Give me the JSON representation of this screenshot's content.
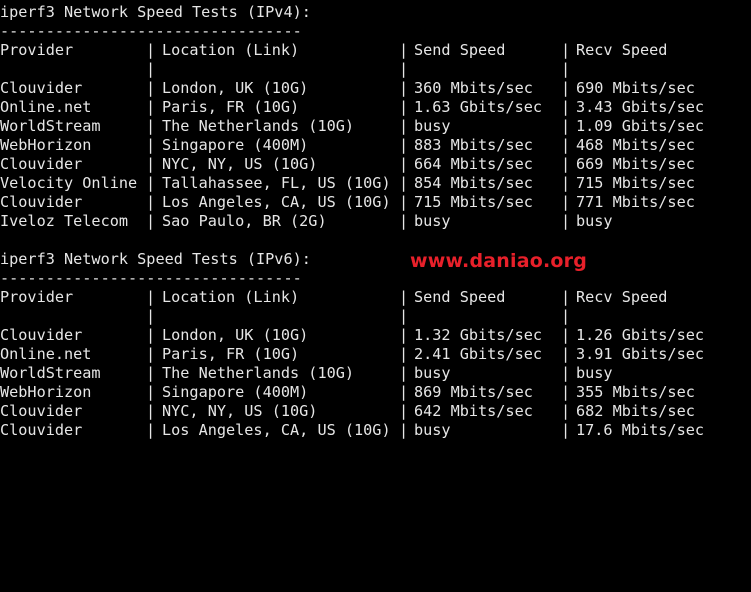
{
  "ipv4": {
    "title": "iperf3 Network Speed Tests (IPv4):",
    "dashes": "---------------------------------",
    "header": {
      "provider": "Provider",
      "location": "Location (Link)",
      "send": "Send Speed",
      "recv": "Recv Speed"
    },
    "separator": "|",
    "rows": [
      {
        "provider": "Clouvider",
        "location": "London, UK (10G)",
        "send": "360 Mbits/sec",
        "recv": "690 Mbits/sec"
      },
      {
        "provider": "Online.net",
        "location": "Paris, FR (10G)",
        "send": "1.63 Gbits/sec",
        "recv": "3.43 Gbits/sec"
      },
      {
        "provider": "WorldStream",
        "location": "The Netherlands (10G)",
        "send": "busy",
        "recv": "1.09 Gbits/sec"
      },
      {
        "provider": "WebHorizon",
        "location": "Singapore (400M)",
        "send": "883 Mbits/sec",
        "recv": "468 Mbits/sec"
      },
      {
        "provider": "Clouvider",
        "location": "NYC, NY, US (10G)",
        "send": "664 Mbits/sec",
        "recv": "669 Mbits/sec"
      },
      {
        "provider": "Velocity Online",
        "location": "Tallahassee, FL, US (10G)",
        "send": "854 Mbits/sec",
        "recv": "715 Mbits/sec"
      },
      {
        "provider": "Clouvider",
        "location": "Los Angeles, CA, US (10G)",
        "send": "715 Mbits/sec",
        "recv": "771 Mbits/sec"
      },
      {
        "provider": "Iveloz Telecom",
        "location": "Sao Paulo, BR (2G)",
        "send": "busy",
        "recv": "busy"
      }
    ]
  },
  "ipv6": {
    "title": "iperf3 Network Speed Tests (IPv6):",
    "dashes": "---------------------------------",
    "header": {
      "provider": "Provider",
      "location": "Location (Link)",
      "send": "Send Speed",
      "recv": "Recv Speed"
    },
    "separator": "|",
    "rows": [
      {
        "provider": "Clouvider",
        "location": "London, UK (10G)",
        "send": "1.32 Gbits/sec",
        "recv": "1.26 Gbits/sec"
      },
      {
        "provider": "Online.net",
        "location": "Paris, FR (10G)",
        "send": "2.41 Gbits/sec",
        "recv": "3.91 Gbits/sec"
      },
      {
        "provider": "WorldStream",
        "location": "The Netherlands (10G)",
        "send": "busy",
        "recv": "busy"
      },
      {
        "provider": "WebHorizon",
        "location": "Singapore (400M)",
        "send": "869 Mbits/sec",
        "recv": "355 Mbits/sec"
      },
      {
        "provider": "Clouvider",
        "location": "NYC, NY, US (10G)",
        "send": "642 Mbits/sec",
        "recv": "682 Mbits/sec"
      },
      {
        "provider": "Clouvider",
        "location": "Los Angeles, CA, US (10G)",
        "send": "busy",
        "recv": "17.6 Mbits/sec"
      }
    ]
  },
  "watermark": "www.daniao.org",
  "colors": {
    "background": "#000000",
    "text": "#e6e6e6",
    "watermark": "#e8202a"
  }
}
